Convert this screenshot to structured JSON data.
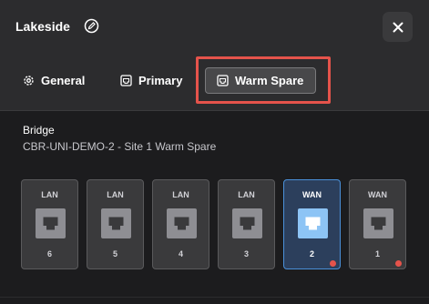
{
  "header": {
    "title": "Lakeside",
    "edit_icon": "edit-pencil-icon",
    "close_icon": "close-icon"
  },
  "tabs": [
    {
      "label": "General",
      "icon": "gear-icon",
      "selected": false
    },
    {
      "label": "Primary",
      "icon": "router-icon",
      "selected": false
    },
    {
      "label": "Warm Spare",
      "icon": "router-icon",
      "selected": true
    }
  ],
  "bridge": {
    "label": "Bridge",
    "name": "CBR-UNI-DEMO-2 - Site 1 Warm Spare"
  },
  "ports": [
    {
      "type": "LAN",
      "number": "6",
      "active": false,
      "alert": false
    },
    {
      "type": "LAN",
      "number": "5",
      "active": false,
      "alert": false
    },
    {
      "type": "LAN",
      "number": "4",
      "active": false,
      "alert": false
    },
    {
      "type": "LAN",
      "number": "3",
      "active": false,
      "alert": false
    },
    {
      "type": "WAN",
      "number": "2",
      "active": true,
      "alert": true
    },
    {
      "type": "WAN",
      "number": "1",
      "active": false,
      "alert": true
    }
  ],
  "colors": {
    "highlight": "#e5534b",
    "active_port_border": "#4a90d9",
    "alert_dot": "#e5534b"
  }
}
